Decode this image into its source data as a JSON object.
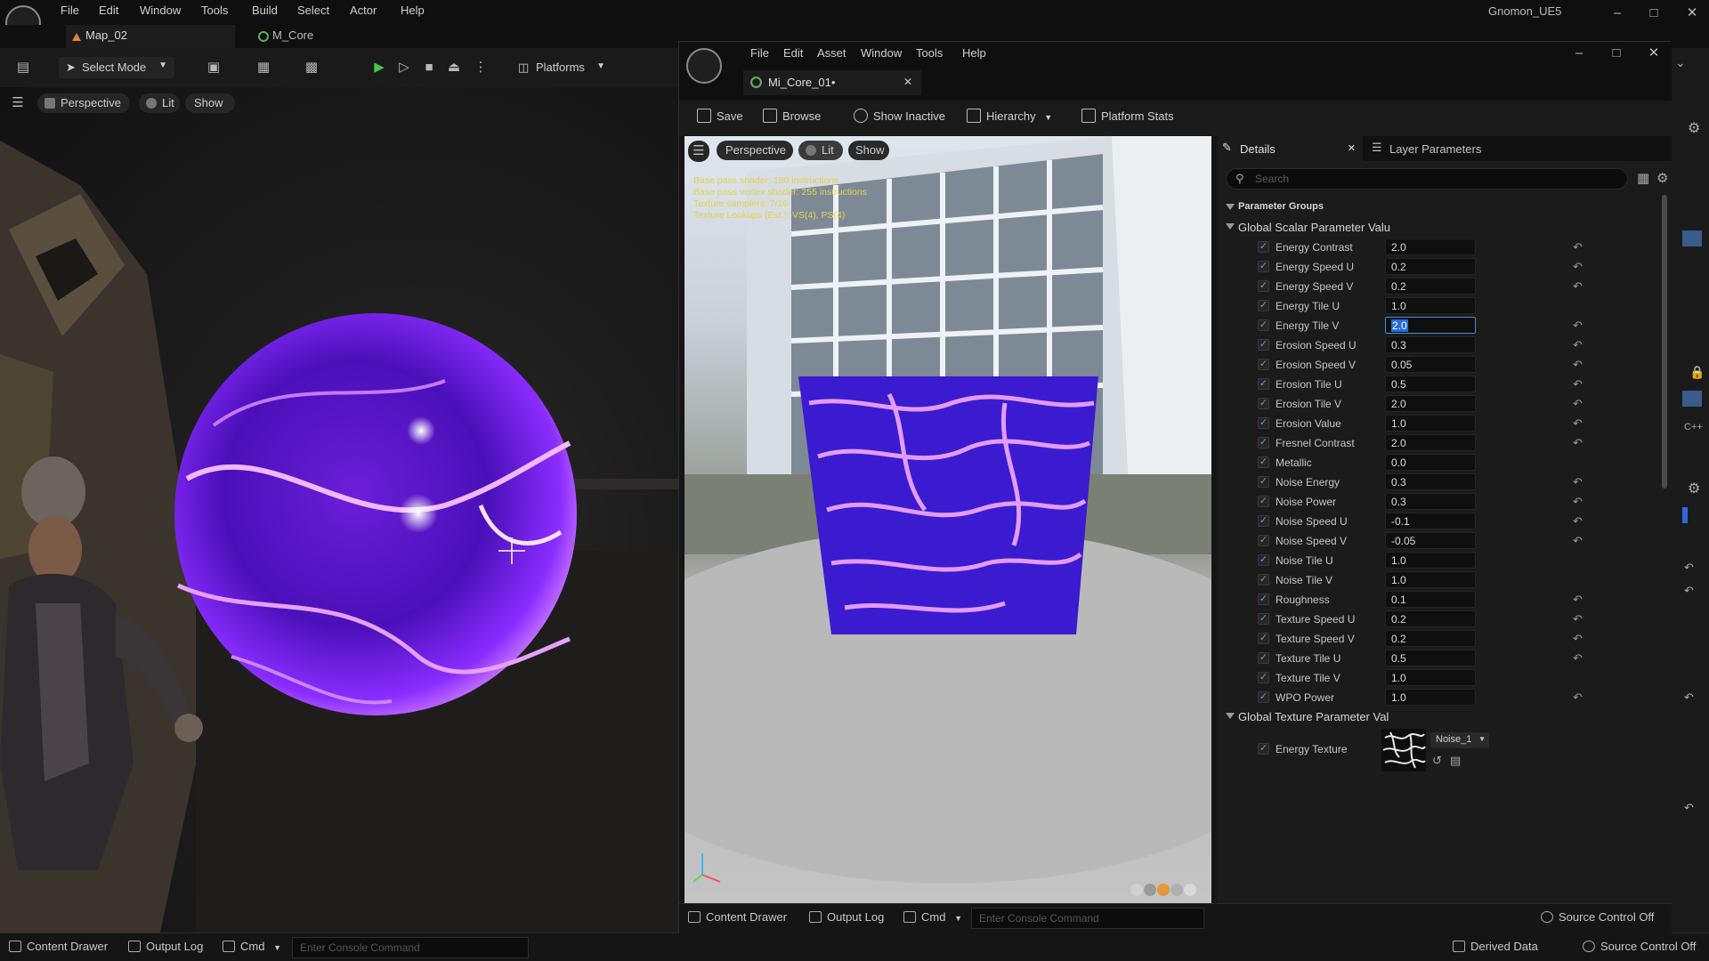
{
  "main": {
    "menu": [
      "File",
      "Edit",
      "Window",
      "Tools",
      "Build",
      "Select",
      "Actor",
      "Help"
    ],
    "project_name": "Gnomon_UE5",
    "tabs": {
      "map": "Map_02",
      "material": "M_Core"
    },
    "toolbar": {
      "select_mode": "Select Mode",
      "platforms": "Platforms"
    },
    "viewport": {
      "perspective": "Perspective",
      "lit": "Lit",
      "show": "Show"
    },
    "status": {
      "content_drawer": "Content Drawer",
      "output_log": "Output Log",
      "cmd": "Cmd",
      "console_placeholder": "Enter Console Command",
      "derived_data": "Derived Data",
      "source_control": "Source Control Off"
    }
  },
  "mi": {
    "menu": [
      "File",
      "Edit",
      "Asset",
      "Window",
      "Tools",
      "Help"
    ],
    "tab_title": "Mi_Core_01•",
    "toolbar": {
      "save": "Save",
      "browse": "Browse",
      "show_inactive": "Show Inactive",
      "hierarchy": "Hierarchy",
      "platform_stats": "Platform Stats"
    },
    "viewport": {
      "perspective": "Perspective",
      "lit": "Lit",
      "show": "Show",
      "stats": [
        "Base pass shader: 180 instructions",
        "Base pass vertex shader: 255 instructions",
        "Texture samplers: 7/16",
        "Texture Lookups (Est.): VS(4), PS(4)"
      ]
    },
    "details": {
      "tab_details": "Details",
      "tab_layers": "Layer Parameters",
      "search_placeholder": "Search",
      "group_root": "Parameter Groups",
      "group_scalar": "Global Scalar Parameter Valu",
      "group_texture": "Global Texture Parameter Val",
      "scalar_params": [
        {
          "name": "Energy Contrast",
          "value": "2.0",
          "reset": true
        },
        {
          "name": "Energy Speed U",
          "value": "0.2",
          "reset": true
        },
        {
          "name": "Energy Speed V",
          "value": "0.2",
          "reset": true
        },
        {
          "name": "Energy Tile U",
          "value": "1.0",
          "reset": false
        },
        {
          "name": "Energy Tile V",
          "value": "2.0",
          "reset": true,
          "active": true
        },
        {
          "name": "Erosion Speed U",
          "value": "0.3",
          "reset": true
        },
        {
          "name": "Erosion Speed V",
          "value": "0.05",
          "reset": true
        },
        {
          "name": "Erosion Tile U",
          "value": "0.5",
          "reset": true
        },
        {
          "name": "Erosion Tile V",
          "value": "2.0",
          "reset": true
        },
        {
          "name": "Erosion Value",
          "value": "1.0",
          "reset": true
        },
        {
          "name": "Fresnel Contrast",
          "value": "2.0",
          "reset": true
        },
        {
          "name": "Metallic",
          "value": "0.0",
          "reset": false
        },
        {
          "name": "Noise Energy",
          "value": "0.3",
          "reset": true
        },
        {
          "name": "Noise Power",
          "value": "0.3",
          "reset": true
        },
        {
          "name": "Noise Speed U",
          "value": "-0.1",
          "reset": true
        },
        {
          "name": "Noise Speed V",
          "value": "-0.05",
          "reset": true
        },
        {
          "name": "Noise Tile U",
          "value": "1.0",
          "reset": false
        },
        {
          "name": "Noise Tile V",
          "value": "1.0",
          "reset": false
        },
        {
          "name": "Roughness",
          "value": "0.1",
          "reset": true
        },
        {
          "name": "Texture Speed U",
          "value": "0.2",
          "reset": true
        },
        {
          "name": "Texture Speed V",
          "value": "0.2",
          "reset": true
        },
        {
          "name": "Texture Tile U",
          "value": "0.5",
          "reset": true
        },
        {
          "name": "Texture Tile V",
          "value": "1.0",
          "reset": false
        },
        {
          "name": "WPO Power",
          "value": "1.0",
          "reset": true
        }
      ],
      "texture_param": {
        "name": "Energy Texture",
        "value": "Noise_1"
      }
    },
    "status": {
      "content_drawer": "Content Drawer",
      "output_log": "Output Log",
      "cmd": "Cmd",
      "console_placeholder": "Enter Console Command",
      "source_control": "Source Control Off"
    }
  },
  "colors": {
    "accent": "#2a6bd8",
    "energy": "#8a2cff",
    "stats_text": "#e3d34a"
  }
}
